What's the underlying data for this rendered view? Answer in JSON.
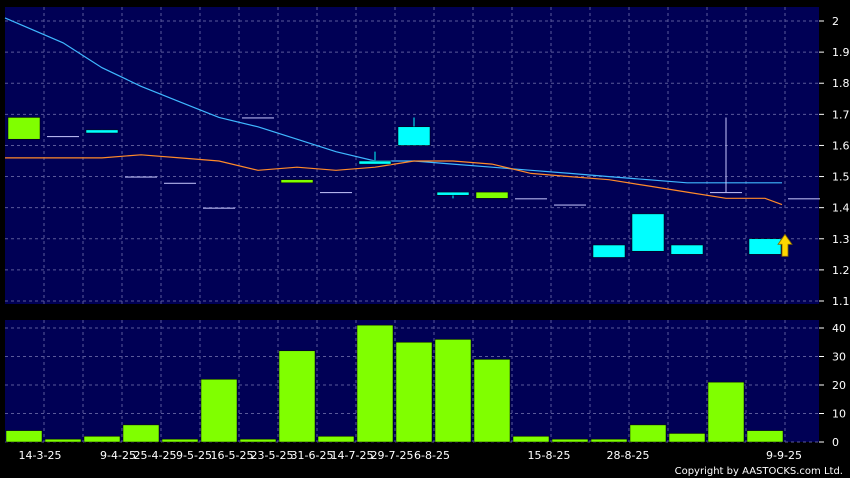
{
  "copyright": "Copyright by AASTOCKS.com Ltd.",
  "colors": {
    "background": "#000000",
    "panel": "#000055",
    "grid": "#5a5a9a",
    "up_candle": "#80ff00",
    "down_candle": "#00ffff",
    "volume_bar": "#80ff00",
    "ma_long": "#3fb8ff",
    "ma_short": "#ff8a2a",
    "signal_arrow": "#ffd700"
  },
  "icons": {
    "signal": "up-arrow-icon"
  },
  "chart_data": [
    {
      "type": "candlestick",
      "title": "",
      "ylim": [
        1.1,
        2.0
      ],
      "yticks": [
        "2",
        "1.9",
        "1.8",
        "1.7",
        "1.6",
        "1.5",
        "1.4",
        "1.3",
        "1.2",
        "1.1"
      ],
      "grid": true,
      "x_labels": [
        "14-3-25",
        "9-4-25",
        "25-4-25",
        "9-5-25",
        "16-5-25",
        "23-5-25",
        "31-6-25",
        "14-7-25",
        "29-7-25",
        "6-8-25",
        "15-8-25",
        "28-8-25",
        "9-9-25"
      ],
      "candles": [
        {
          "open": 1.62,
          "high": 1.69,
          "low": 1.62,
          "close": 1.69,
          "color": "up"
        },
        {
          "open": 1.63,
          "high": 1.63,
          "low": 1.63,
          "close": 1.63,
          "color": "flat"
        },
        {
          "open": 1.65,
          "high": 1.65,
          "low": 1.64,
          "close": 1.64,
          "color": "down"
        },
        {
          "open": 1.5,
          "high": 1.5,
          "low": 1.5,
          "close": 1.5,
          "color": "flat"
        },
        {
          "open": 1.48,
          "high": 1.48,
          "low": 1.48,
          "close": 1.48,
          "color": "flat"
        },
        {
          "open": 1.4,
          "high": 1.4,
          "low": 1.4,
          "close": 1.4,
          "color": "flat"
        },
        {
          "open": 1.69,
          "high": 1.69,
          "low": 1.69,
          "close": 1.69,
          "color": "flat"
        },
        {
          "open": 1.48,
          "high": 1.49,
          "low": 1.48,
          "close": 1.49,
          "color": "up"
        },
        {
          "open": 1.45,
          "high": 1.45,
          "low": 1.45,
          "close": 1.45,
          "color": "flat"
        },
        {
          "open": 1.55,
          "high": 1.58,
          "low": 1.54,
          "close": 1.54,
          "color": "down"
        },
        {
          "open": 1.66,
          "high": 1.69,
          "low": 1.6,
          "close": 1.6,
          "color": "down"
        },
        {
          "open": 1.45,
          "high": 1.45,
          "low": 1.43,
          "close": 1.44,
          "color": "down"
        },
        {
          "open": 1.43,
          "high": 1.45,
          "low": 1.43,
          "close": 1.45,
          "color": "up"
        },
        {
          "open": 1.43,
          "high": 1.43,
          "low": 1.43,
          "close": 1.43,
          "color": "flat"
        },
        {
          "open": 1.41,
          "high": 1.41,
          "low": 1.41,
          "close": 1.41,
          "color": "flat"
        },
        {
          "open": 1.28,
          "high": 1.28,
          "low": 1.24,
          "close": 1.24,
          "color": "down"
        },
        {
          "open": 1.38,
          "high": 1.38,
          "low": 1.26,
          "close": 1.26,
          "color": "down"
        },
        {
          "open": 1.28,
          "high": 1.28,
          "low": 1.25,
          "close": 1.25,
          "color": "down"
        },
        {
          "open": 1.45,
          "high": 1.69,
          "low": 1.45,
          "close": 1.45,
          "color": "flat"
        },
        {
          "open": 1.3,
          "high": 1.3,
          "low": 1.25,
          "close": 1.25,
          "color": "down"
        },
        {
          "open": 1.43,
          "high": 1.43,
          "low": 1.43,
          "close": 1.43,
          "color": "flat"
        }
      ],
      "series": [
        {
          "values": [
            2.01,
            1.93,
            1.85,
            1.79,
            1.74,
            1.69,
            1.66,
            1.62,
            1.58,
            1.55,
            1.55,
            1.54,
            1.53,
            1.52,
            1.51,
            1.5,
            1.49,
            1.48,
            1.48,
            1.48
          ]
        },
        {
          "values": [
            1.56,
            1.56,
            1.56,
            1.57,
            1.56,
            1.55,
            1.52,
            1.53,
            1.52,
            1.53,
            1.55,
            1.55,
            1.54,
            1.51,
            1.5,
            1.49,
            1.47,
            1.45,
            1.43,
            1.43,
            1.41
          ]
        }
      ],
      "signal_marker": {
        "candle_index": 19,
        "direction": "up"
      }
    },
    {
      "type": "bar",
      "title": "",
      "ylim": [
        0,
        40
      ],
      "yticks": [
        "40",
        "30",
        "20",
        "10",
        "0"
      ],
      "grid": true,
      "values": [
        4,
        1,
        2,
        6,
        1,
        22,
        1,
        32,
        2,
        41,
        35,
        36,
        29,
        2,
        1,
        1,
        6,
        3,
        21,
        4
      ]
    }
  ]
}
